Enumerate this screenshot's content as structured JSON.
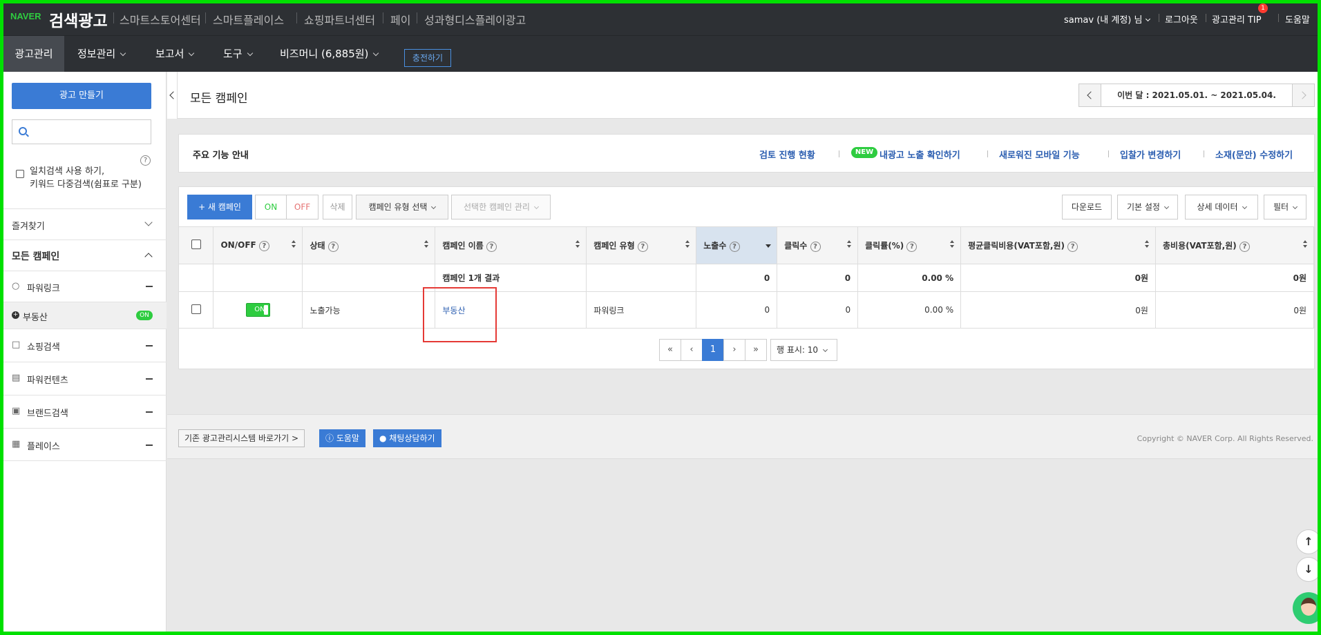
{
  "topbar": {
    "logo": "NAVER",
    "title": "검색광고",
    "services": [
      "스마트스토어센터",
      "스마트플레이스",
      "쇼핑파트너센터",
      "페이",
      "성과형디스플레이광고"
    ],
    "account": "samav (내 계정) 님",
    "logout": "로그아웃",
    "tip": "광고관리 TIP",
    "tip_badge": "1",
    "help": "도움말"
  },
  "nav": {
    "items": [
      "광고관리",
      "정보관리",
      "보고서",
      "도구",
      "비즈머니 (6,885원)"
    ],
    "charge": "충전하기"
  },
  "sidebar": {
    "make_button": "광고 만들기",
    "search_placeholder": "",
    "help": "?",
    "option_line1": "일치검색 사용 하기,",
    "option_line2": "키워드 다중검색(쉼표로 구분)",
    "favorites": "즐겨찾기",
    "all_campaigns": "모든 캠페인",
    "powerlink": "파워링크",
    "campaign_item": "부동산",
    "campaign_status": "ON",
    "shopping": "쇼핑검색",
    "powercontents": "파워컨텐츠",
    "brand": "브랜드검색",
    "place": "플레이스"
  },
  "header": {
    "title": "모든 캠페인",
    "date_range": "이번 달 : 2021.05.01. ~ 2021.05.04."
  },
  "guide": {
    "title": "주요 기능 안내",
    "links": [
      "검토 진행 현황",
      "내광고 노출 확인하기",
      "새로워진 모바일 기능",
      "입찰가 변경하기",
      "소재(문안) 수정하기"
    ],
    "new_badge": "NEW"
  },
  "toolbar": {
    "new_campaign": "+ 새 캠페인",
    "on": "ON",
    "off": "OFF",
    "delete": "삭제",
    "type_select": "캠페인 유형 선택",
    "manage": "선택한 캠페인 관리",
    "download": "다운로드",
    "basic_settings": "기본 설정",
    "detail_data": "상세 데이터",
    "filter": "필터"
  },
  "table": {
    "headers": [
      "ON/OFF",
      "상태",
      "캠페인 이름",
      "캠페인 유형",
      "노출수",
      "클릭수",
      "클릭률(%)",
      "평균클릭비용(VAT포함,원)",
      "총비용(VAT포함,원)"
    ],
    "summary": {
      "label": "캠페인 1개 결과",
      "impressions": "0",
      "clicks": "0",
      "ctr": "0.00 %",
      "avg_cpc": "0원",
      "total_cost": "0원"
    },
    "rows": [
      {
        "toggle": "ON",
        "status": "노출가능",
        "name": "부동산",
        "type": "파워링크",
        "impressions": "0",
        "clicks": "0",
        "ctr": "0.00 %",
        "avg_cpc": "0원",
        "total_cost": "0원"
      }
    ]
  },
  "pagination": {
    "first": "«",
    "prev": "‹",
    "current": "1",
    "next": "›",
    "last": "»",
    "rows_per_page": "행 표시: 10"
  },
  "footer": {
    "legacy": "기존 광고관리시스템 바로가기 >",
    "help": "도움말",
    "chat": "채팅상담하기",
    "copyright": "Copyright © NAVER Corp. All Rights Reserved."
  },
  "floating": {
    "up": "↑",
    "down": "↓"
  }
}
